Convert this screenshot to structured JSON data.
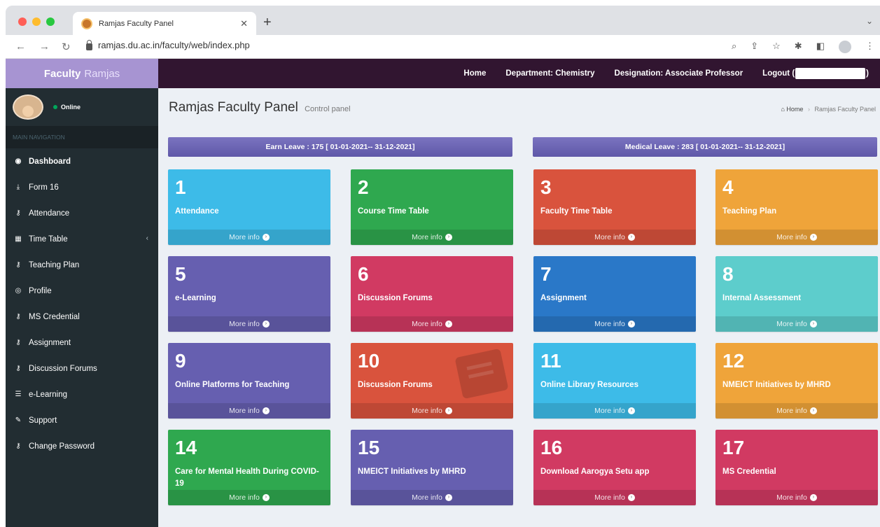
{
  "browser": {
    "tab_title": "Ramjas Faculty Panel",
    "url": "ramjas.du.ac.in/faculty/web/index.php"
  },
  "header": {
    "logo_bold": "Faculty",
    "logo_light": "Ramjas",
    "nav": {
      "home": "Home",
      "department": "Department: Chemistry",
      "designation": "Designation: Associate Professor",
      "logout_prefix": "Logout (",
      "logout_suffix": ")"
    }
  },
  "sidebar": {
    "status": "Online",
    "nav_header": "MAIN NAVIGATION",
    "items": [
      {
        "label": "Dashboard",
        "icon": "dashboard-icon"
      },
      {
        "label": "Form 16",
        "icon": "download-icon"
      },
      {
        "label": "Attendance",
        "icon": "key-icon"
      },
      {
        "label": "Time Table",
        "icon": "calendar-icon"
      },
      {
        "label": "Teaching Plan",
        "icon": "key-icon"
      },
      {
        "label": "Profile",
        "icon": "user-icon"
      },
      {
        "label": "MS Credential",
        "icon": "key-icon"
      },
      {
        "label": "Assignment",
        "icon": "key-icon"
      },
      {
        "label": "Discussion Forums",
        "icon": "key-icon"
      },
      {
        "label": "e-Learning",
        "icon": "list-icon"
      },
      {
        "label": "Support",
        "icon": "wrench-icon"
      },
      {
        "label": "Change Password",
        "icon": "key-icon"
      }
    ]
  },
  "main": {
    "title": "Ramjas Faculty Panel",
    "subtitle": "Control panel",
    "breadcrumb": {
      "home": "Home",
      "current": "Ramjas Faculty Panel"
    },
    "earn_leave": "Earn Leave : 175 [ 01-01-2021-- 31-12-2021]",
    "medical_leave": "Medical Leave : 283 [ 01-01-2021-- 31-12-2021]",
    "more_info": "More info",
    "boxes": [
      {
        "num": "1",
        "label": "Attendance",
        "color": "#3dbbe8"
      },
      {
        "num": "2",
        "label": "Course Time Table",
        "color": "#2fa84f"
      },
      {
        "num": "3",
        "label": "Faculty Time Table",
        "color": "#d9533d"
      },
      {
        "num": "4",
        "label": "Teaching Plan",
        "color": "#efa43a"
      },
      {
        "num": "5",
        "label": "e-Learning",
        "color": "#665fb0"
      },
      {
        "num": "6",
        "label": "Discussion Forums",
        "color": "#d13a62"
      },
      {
        "num": "7",
        "label": "Assignment",
        "color": "#2a78c8"
      },
      {
        "num": "8",
        "label": "Internal Assessment",
        "color": "#5dcdcc"
      },
      {
        "num": "9",
        "label": "Online Platforms for Teaching",
        "color": "#665fb0"
      },
      {
        "num": "10",
        "label": "Discussion Forums",
        "color": "#d9533d"
      },
      {
        "num": "11",
        "label": "Online Library Resources",
        "color": "#3dbbe8"
      },
      {
        "num": "12",
        "label": "NMEICT Initiatives by MHRD",
        "color": "#efa43a"
      },
      {
        "num": "14",
        "label": "Care for Mental Health During COVID-19",
        "color": "#2fa84f"
      },
      {
        "num": "15",
        "label": "NMEICT Initiatives by MHRD",
        "color": "#665fb0"
      },
      {
        "num": "16",
        "label": "Download Aarogya Setu app",
        "color": "#d13a62"
      },
      {
        "num": "17",
        "label": "MS Credential",
        "color": "#d13a62"
      }
    ]
  }
}
